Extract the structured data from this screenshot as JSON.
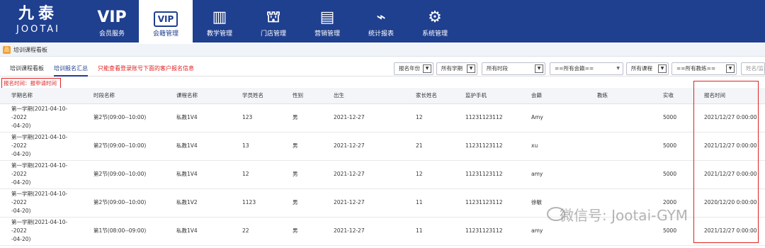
{
  "app": {
    "logo_cn": "九泰",
    "logo_en": "JOOTAI"
  },
  "nav": [
    {
      "icon": "VIP",
      "label": "会员服务",
      "active": false
    },
    {
      "icon": "VIP",
      "label": "会籍管理",
      "active": true
    },
    {
      "icon": "▥",
      "label": "教学管理",
      "active": false
    },
    {
      "icon": "⛫",
      "label": "门店管理",
      "active": false
    },
    {
      "icon": "▤",
      "label": "营销管理",
      "active": false
    },
    {
      "icon": "⌁",
      "label": "统计报表",
      "active": false
    },
    {
      "icon": "⚙",
      "label": "系统管理",
      "active": false
    }
  ],
  "breadcrumb": "培训课程看板",
  "tabs": [
    "培训课程看板",
    "培训报名汇总"
  ],
  "note": "只能查看登录账号下面的客户报名信息",
  "filters": {
    "year": "报名年份",
    "term": "所有学期",
    "period": "所有时段",
    "membership": "==所有会籍==",
    "course": "所有课程",
    "coach": "==所有教练==",
    "search_placeholder": "姓名/监护"
  },
  "time_note": "报名时间：报申请时间",
  "table": {
    "headers": [
      "学期名称",
      "时段名称",
      "课程名称",
      "学员姓名",
      "性别",
      "出生",
      "家长姓名",
      "监护手机",
      "会籍",
      "教练",
      "实收",
      "报名时间"
    ],
    "rows": [
      {
        "term": [
          "第一学期(2021-04-10--2022",
          "-04-20)"
        ],
        "period": "第2节(09:00--10:00)",
        "course": "私教1V4",
        "student": "123",
        "gender": "男",
        "birth": "2021-12-27",
        "parent": "12",
        "phone": "11231123112",
        "membership": "Amy",
        "coach": "",
        "paid": "5000",
        "time": "2021/12/27 0:00:00"
      },
      {
        "term": [
          "第一学期(2021-04-10--2022",
          "-04-20)"
        ],
        "period": "第2节(09:00--10:00)",
        "course": "私教1V4",
        "student": "13",
        "gender": "男",
        "birth": "2021-12-27",
        "parent": "21",
        "phone": "11231123112",
        "membership": "xu",
        "coach": "",
        "paid": "5000",
        "time": "2021/12/27 0:00:00"
      },
      {
        "term": [
          "第一学期(2021-04-10--2022",
          "-04-20)"
        ],
        "period": "第2节(09:00--10:00)",
        "course": "私教1V4",
        "student": "12",
        "gender": "男",
        "birth": "2021-12-27",
        "parent": "12",
        "phone": "11231123112",
        "membership": "amy",
        "coach": "",
        "paid": "5000",
        "time": "2021/12/27 0:00:00"
      },
      {
        "term": [
          "第一学期(2021-04-10--2022",
          "-04-20)"
        ],
        "period": "第2节(09:00--10:00)",
        "course": "私教1V2",
        "student": "1123",
        "gender": "男",
        "birth": "2021-12-27",
        "parent": "11",
        "phone": "11231123112",
        "membership": "徐敏",
        "coach": "",
        "paid": "2000",
        "time": "2020/12/20 0:00:00"
      },
      {
        "term": [
          "第一学期(2021-04-10--2022",
          "-04-20)"
        ],
        "period": "第1节(08:00--09:00)",
        "course": "私教1V4",
        "student": "22",
        "gender": "男",
        "birth": "2021-12-27",
        "parent": "11",
        "phone": "11231123112",
        "membership": "amy",
        "coach": "",
        "paid": "5000",
        "time": "2021/12/27 0:00:00"
      }
    ]
  },
  "watermark": "微信号: Jootai-GYM",
  "colors": {
    "primary": "#1f3f8f",
    "highlight": "#e02020"
  }
}
